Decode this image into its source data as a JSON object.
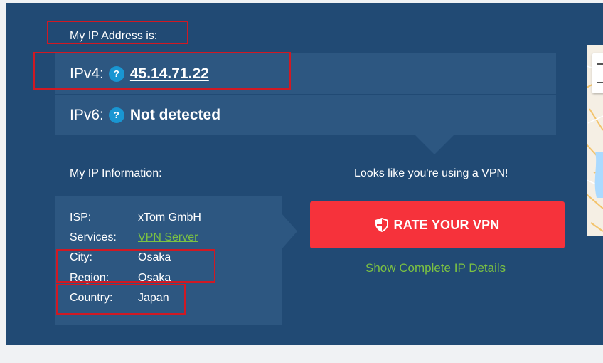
{
  "heading": "My IP Address is:",
  "ipv4": {
    "label": "IPv4:",
    "help": "?",
    "value": "45.14.71.22"
  },
  "ipv6": {
    "label": "IPv6:",
    "help": "?",
    "value": "Not detected"
  },
  "info_heading": "My IP Information:",
  "vpn_note": "Looks like you're using a VPN!",
  "info": {
    "isp": {
      "key": "ISP:",
      "value": "xTom GmbH"
    },
    "services": {
      "key": "Services:",
      "value": "VPN Server"
    },
    "city": {
      "key": "City:",
      "value": "Osaka"
    },
    "region": {
      "key": "Region:",
      "value": "Osaka"
    },
    "country": {
      "key": "Country:",
      "value": "Japan"
    }
  },
  "rate_button": "RATE YOUR VPN",
  "details_link": "Show Complete IP Details",
  "icons": {
    "help": "question-mark-icon",
    "shield": "shield-icon"
  },
  "colors": {
    "panel": "#214a74",
    "box": "#2d5781",
    "accent_red": "#f6323b",
    "link_green": "#7cc242",
    "help_blue": "#1996d2",
    "highlight_red": "#d01923"
  }
}
